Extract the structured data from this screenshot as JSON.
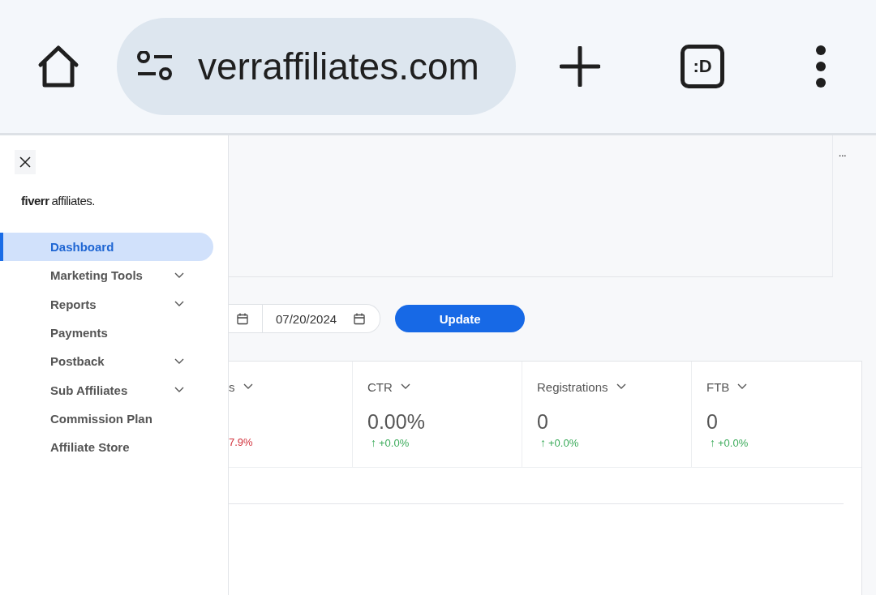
{
  "browser": {
    "url": "verraffiliates.com",
    "tab_button": ":D"
  },
  "sidebar": {
    "logo_bold": "fiverr",
    "logo_rest": "affiliates.",
    "items": [
      {
        "label": "Dashboard",
        "selected": true,
        "expandable": false
      },
      {
        "label": "Marketing Tools",
        "selected": false,
        "expandable": true
      },
      {
        "label": "Reports",
        "selected": false,
        "expandable": true
      },
      {
        "label": "Payments",
        "selected": false,
        "expandable": false
      },
      {
        "label": "Postback",
        "selected": false,
        "expandable": true
      },
      {
        "label": "Sub Affiliates",
        "selected": false,
        "expandable": true
      },
      {
        "label": "Commission Plan",
        "selected": false,
        "expandable": false
      },
      {
        "label": "Affiliate Store",
        "selected": false,
        "expandable": false
      }
    ]
  },
  "main": {
    "more": "···",
    "date_fields": [
      {
        "cut_off": true
      },
      {
        "value": "07/20/2024",
        "cut_off": false
      }
    ],
    "update_button": "Update",
    "metrics": [
      {
        "label": "s",
        "change": "7.9%",
        "negative": true
      },
      {
        "label": "CTR",
        "value": "0.00%",
        "arrow": "↑",
        "change": "+0.0%",
        "negative": false
      },
      {
        "label": "Registrations",
        "value": "0",
        "arrow": "↑",
        "change": "+0.0%",
        "negative": false
      },
      {
        "label": "FTB",
        "value": "0",
        "arrow": "↑",
        "change": "+0.0%",
        "negative": false
      }
    ]
  }
}
